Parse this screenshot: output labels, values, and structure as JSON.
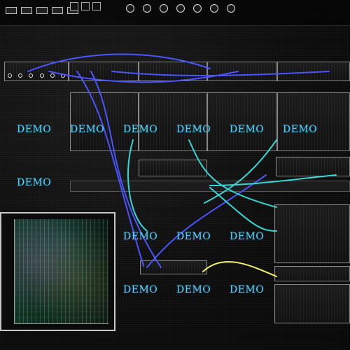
{
  "watermark": {
    "text": "DEMO",
    "color": "#57d2ff"
  },
  "ui": {
    "accent_cable_blue": "#4a55ff",
    "accent_cable_cyan": "#35d7d2",
    "accent_cable_yellow": "#f3f06a"
  }
}
